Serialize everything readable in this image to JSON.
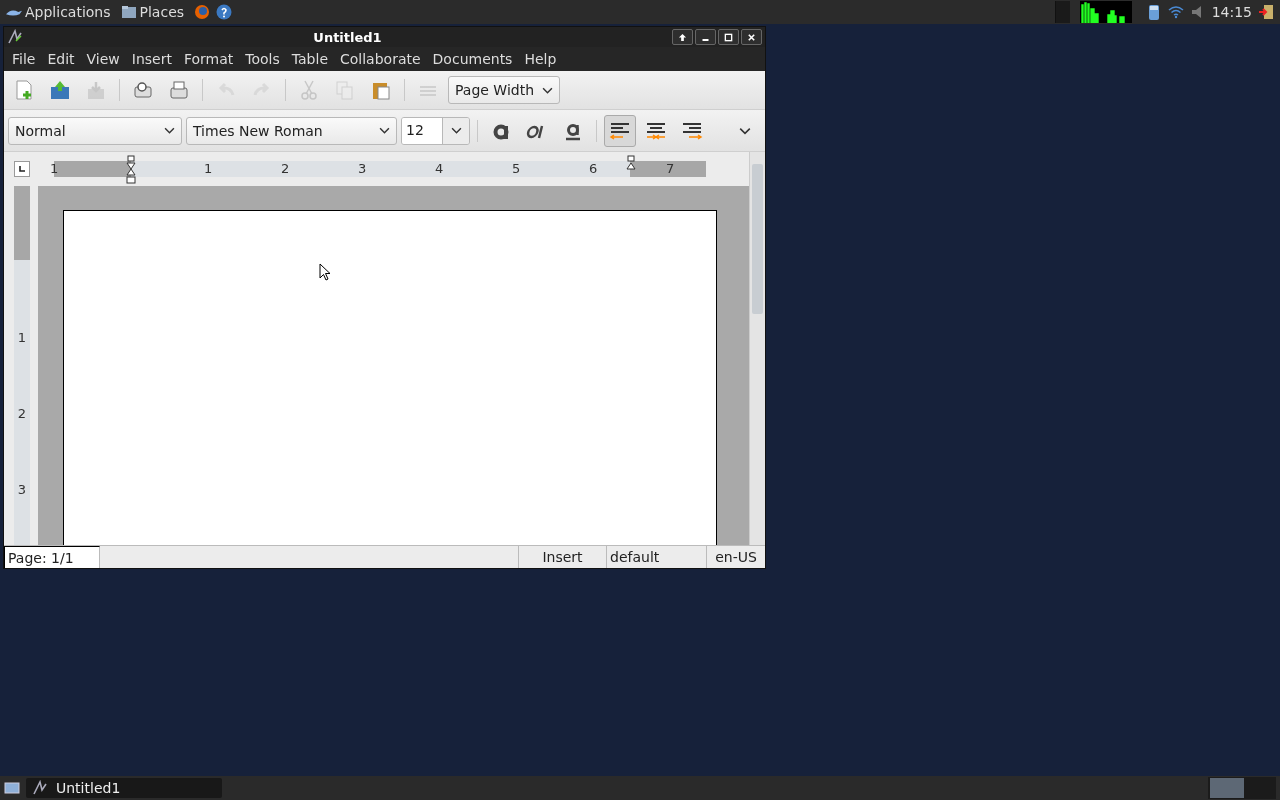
{
  "top_panel": {
    "menus": [
      "Applications",
      "Places"
    ],
    "clock": "14:15"
  },
  "window": {
    "title": "Untitled1"
  },
  "menu": [
    "File",
    "Edit",
    "View",
    "Insert",
    "Format",
    "Tools",
    "Table",
    "Collaborate",
    "Documents",
    "Help"
  ],
  "toolbar": [
    {
      "kind": "new",
      "disabled": false
    },
    {
      "kind": "open",
      "disabled": false
    },
    {
      "kind": "save",
      "disabled": true
    },
    {
      "kind": "sep"
    },
    {
      "kind": "preview",
      "disabled": false
    },
    {
      "kind": "print",
      "disabled": false
    },
    {
      "kind": "sep"
    },
    {
      "kind": "undo",
      "disabled": true
    },
    {
      "kind": "redo",
      "disabled": true
    },
    {
      "kind": "sep"
    },
    {
      "kind": "cut",
      "disabled": true
    },
    {
      "kind": "copy",
      "disabled": true
    },
    {
      "kind": "paste",
      "disabled": false
    },
    {
      "kind": "sep"
    },
    {
      "kind": "spell",
      "disabled": true
    }
  ],
  "zoom": "Page Width",
  "format_bar": {
    "style": "Normal",
    "font": "Times New Roman",
    "size": "12",
    "text_styles": [
      {
        "kind": "bold"
      },
      {
        "kind": "italic"
      },
      {
        "kind": "underline"
      }
    ],
    "align": [
      {
        "kind": "left",
        "selected": true
      },
      {
        "kind": "center",
        "selected": false
      },
      {
        "kind": "right",
        "selected": false
      }
    ]
  },
  "ruler": {
    "labels": [
      "1",
      "1",
      "2",
      "3",
      "4",
      "5",
      "6",
      "7"
    ]
  },
  "vertical_ruler": {
    "labels": [
      "1",
      "2",
      "3"
    ]
  },
  "status_bar": {
    "page": "Page: 1/1",
    "mode": "Insert",
    "style": "default",
    "language": "en-US"
  },
  "taskbar": {
    "tasks": [
      {
        "title": "Untitled1"
      }
    ]
  }
}
